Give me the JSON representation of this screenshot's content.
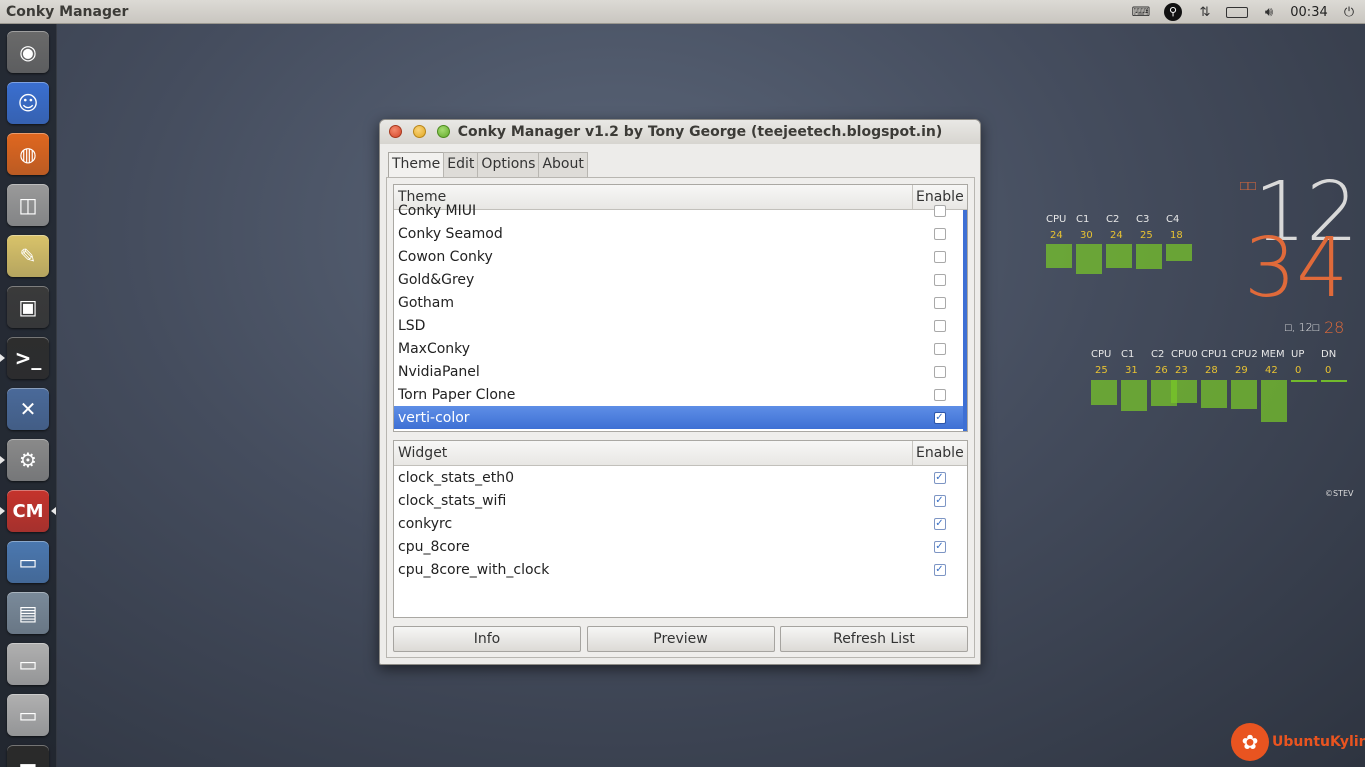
{
  "panel": {
    "app_title": "Conky Manager",
    "clock": "00:34",
    "icons": [
      "keyboard-icon",
      "search-icon",
      "network-icon",
      "battery-icon",
      "volume-icon",
      "power-icon"
    ]
  },
  "launcher": {
    "items": [
      {
        "name": "ubuntu-dash",
        "glyph": "◉",
        "color": "#6a6a6a"
      },
      {
        "name": "finder",
        "glyph": "☺",
        "color": "#3a6fd0"
      },
      {
        "name": "firefox",
        "glyph": "◍",
        "color": "#e0671f"
      },
      {
        "name": "camera",
        "glyph": "◫",
        "color": "#9a9a9a"
      },
      {
        "name": "text-editor",
        "glyph": "✎",
        "color": "#d9c36a"
      },
      {
        "name": "media",
        "glyph": "▣",
        "color": "#3a3a3a"
      },
      {
        "name": "terminal",
        "glyph": ">_",
        "color": "#2d2d2d"
      },
      {
        "name": "system-tools",
        "glyph": "✕",
        "color": "#4a6a9a"
      },
      {
        "name": "settings",
        "glyph": "⚙",
        "color": "#8a8a8a"
      },
      {
        "name": "conky-manager",
        "glyph": "CM",
        "color": "#c5332c"
      },
      {
        "name": "window-app",
        "glyph": "▭",
        "color": "#4b78b0"
      },
      {
        "name": "system-monitor",
        "glyph": "▤",
        "color": "#7a8a9a"
      },
      {
        "name": "drive-1",
        "glyph": "▭",
        "color": "#b0b0b0"
      },
      {
        "name": "drive-2",
        "glyph": "▭",
        "color": "#b0b0b0"
      },
      {
        "name": "trash",
        "glyph": "▬",
        "color": "#2a2a2a"
      }
    ]
  },
  "window": {
    "title": "Conky Manager v1.2 by Tony George (teejeetech.blogspot.in)",
    "tabs": [
      {
        "label": "Theme",
        "active": true
      },
      {
        "label": "Edit",
        "active": false
      },
      {
        "label": "Options",
        "active": false
      },
      {
        "label": "About",
        "active": false
      }
    ],
    "theme_list": {
      "col_name": "Theme",
      "col_enable": "Enable",
      "rows": [
        {
          "name": "Conky MIUI",
          "enabled": false,
          "selected": false
        },
        {
          "name": "Conky Seamod",
          "enabled": false,
          "selected": false
        },
        {
          "name": "Cowon Conky",
          "enabled": false,
          "selected": false
        },
        {
          "name": "Gold&Grey",
          "enabled": false,
          "selected": false
        },
        {
          "name": "Gotham",
          "enabled": false,
          "selected": false
        },
        {
          "name": "LSD",
          "enabled": false,
          "selected": false
        },
        {
          "name": "MaxConky",
          "enabled": false,
          "selected": false
        },
        {
          "name": "NvidiaPanel",
          "enabled": false,
          "selected": false
        },
        {
          "name": "Torn Paper Clone",
          "enabled": false,
          "selected": false
        },
        {
          "name": "verti-color",
          "enabled": true,
          "selected": true
        }
      ]
    },
    "widget_list": {
      "col_name": "Widget",
      "col_enable": "Enable",
      "rows": [
        {
          "name": "clock_stats_eth0",
          "enabled": true
        },
        {
          "name": "clock_stats_wifi",
          "enabled": true
        },
        {
          "name": "conkyrc",
          "enabled": true
        },
        {
          "name": "cpu_8core",
          "enabled": true
        },
        {
          "name": "cpu_8core_with_clock",
          "enabled": true
        }
      ]
    },
    "buttons": {
      "info": "Info",
      "preview": "Preview",
      "refresh": "Refresh List"
    }
  },
  "conky_top": {
    "labels": [
      "CPU",
      "C1",
      "C2",
      "C3",
      "C4"
    ],
    "values": [
      "24",
      "30",
      "24",
      "25",
      "18"
    ],
    "fill": [
      0.52,
      0.65,
      0.52,
      0.55,
      0.38
    ]
  },
  "conky_clock": {
    "hour": "12",
    "minute": "34",
    "date_text": "□, 12□",
    "day": "28",
    "marker": "□□"
  },
  "conky_bottom": {
    "labels": [
      "CPU",
      "C1",
      "C2",
      "CPU0",
      "CPU1",
      "CPU2",
      "MEM",
      "UP",
      "DN"
    ],
    "values": [
      "25",
      "31",
      "26",
      "23",
      "28",
      "29",
      "42",
      "0",
      "0"
    ],
    "fill": [
      0.5,
      0.62,
      0.52,
      0.46,
      0.56,
      0.58,
      0.84,
      0.0,
      0.0
    ]
  },
  "conky_credit": "©STEV",
  "brand": {
    "text": "UbuntuKylin",
    "color": "#e95420"
  },
  "accent": "#3e70d4"
}
